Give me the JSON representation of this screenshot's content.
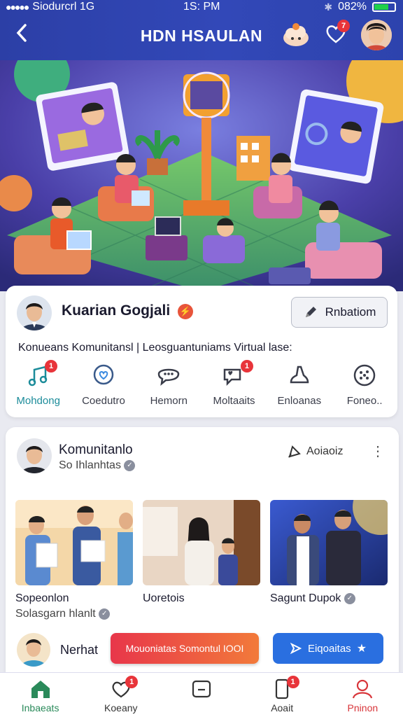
{
  "status_bar": {
    "carrier": "Siodurcrl 1G",
    "time": "1S: PM",
    "battery": "082%"
  },
  "header": {
    "title": "HDN HSAULAN",
    "notification_count": "7"
  },
  "profile": {
    "name": "Kuarian Gogjali",
    "action_label": "Rnbatiom",
    "tagline": "Konueans Komunitansl | Leosguantuniams Virtual lase:",
    "quick_items": [
      {
        "label": "Mohdong",
        "icon": "music-icon",
        "badge": "1"
      },
      {
        "label": "Coedutro",
        "icon": "chat-heart-icon",
        "badge": ""
      },
      {
        "label": "Hemorn",
        "icon": "speech-bubble-icon",
        "badge": ""
      },
      {
        "label": "Moltaaits",
        "icon": "comments-icon",
        "badge": "1"
      },
      {
        "label": "Enloanas",
        "icon": "bell-icon",
        "badge": ""
      },
      {
        "label": "Foneo..",
        "icon": "dots-circle-icon",
        "badge": ""
      }
    ]
  },
  "community": {
    "name": "Komunitanlo",
    "subtitle": "So Ihlanhtas",
    "action_label": "Aoiaoiz",
    "photos": [
      {
        "title": "Sopeonlon",
        "subtitle": "Solasgarn hlanlt"
      },
      {
        "title": "Uoretois",
        "subtitle": ""
      },
      {
        "title": "Sagunt Dupok",
        "subtitle": ""
      }
    ],
    "footer_label": "Nerhat",
    "primary_button": "Mouoniatas Somontul IOOI",
    "secondary_button": "Eiqoaitas"
  },
  "nav": {
    "items": [
      {
        "label": "Inbaeats",
        "badge": ""
      },
      {
        "label": "Koeany",
        "badge": "1"
      },
      {
        "label": "",
        "badge": ""
      },
      {
        "label": "Aoait",
        "badge": "1"
      },
      {
        "label": "Pninon",
        "badge": ""
      }
    ]
  },
  "colors": {
    "header": "#2f45b0",
    "accent_red": "#e8343a",
    "accent_blue": "#2a6fe0",
    "active_teal": "#1c8c9a"
  }
}
